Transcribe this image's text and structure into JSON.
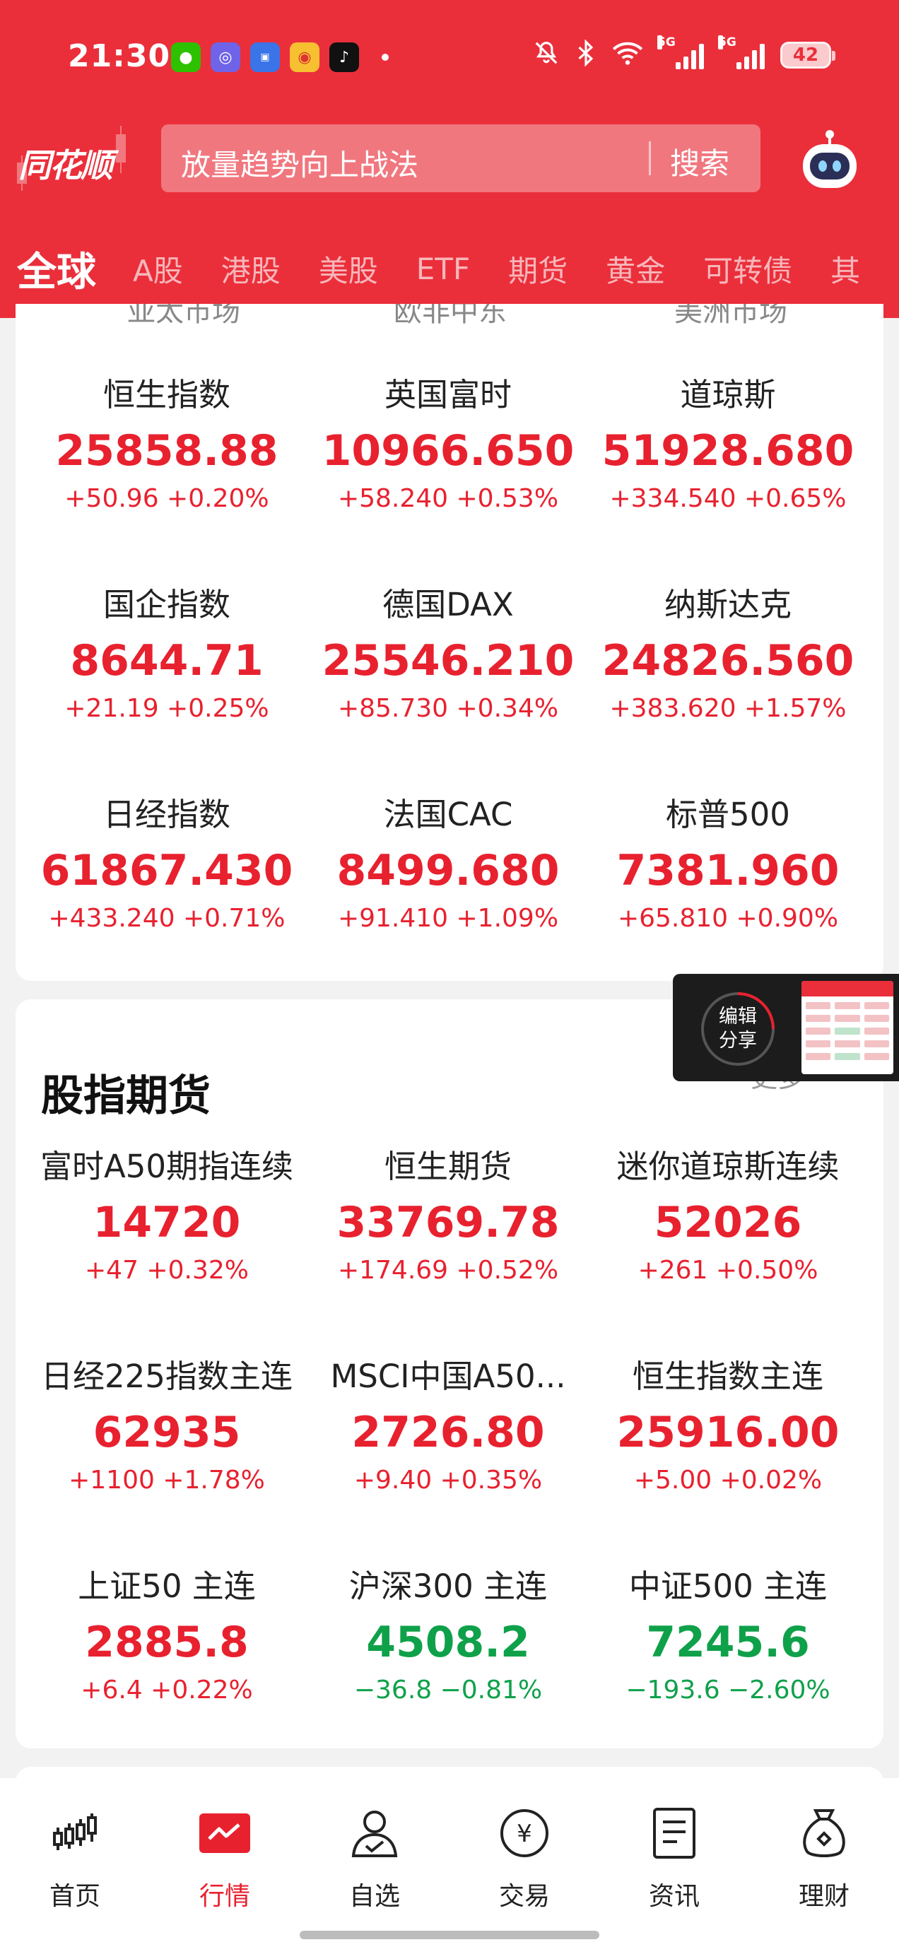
{
  "status_bar": {
    "time": "21:30",
    "network_1": "5G",
    "network_2": "5G",
    "battery": "42"
  },
  "header": {
    "logo": "同花顺",
    "search_placeholder": "放量趋势向上战法",
    "search_button": "搜索"
  },
  "tabs": [
    {
      "label": "全球",
      "active": true
    },
    {
      "label": "A股"
    },
    {
      "label": "港股"
    },
    {
      "label": "美股"
    },
    {
      "label": "ETF"
    },
    {
      "label": "期货"
    },
    {
      "label": "黄金"
    },
    {
      "label": "可转债"
    },
    {
      "label": "其"
    }
  ],
  "global_indices": {
    "cut_labels": [
      "亚太市场",
      "欧非中东",
      "美洲市场"
    ],
    "items": [
      {
        "name": "恒生指数",
        "price": "25858.88",
        "change": "+50.96  +0.20%",
        "dir": "up"
      },
      {
        "name": "英国富时",
        "price": "10966.650",
        "change": "+58.240  +0.53%",
        "dir": "up"
      },
      {
        "name": "道琼斯",
        "price": "51928.680",
        "change": "+334.540  +0.65%",
        "dir": "up"
      },
      {
        "name": "国企指数",
        "price": "8644.71",
        "change": "+21.19  +0.25%",
        "dir": "up"
      },
      {
        "name": "德国DAX",
        "price": "25546.210",
        "change": "+85.730  +0.34%",
        "dir": "up"
      },
      {
        "name": "纳斯达克",
        "price": "24826.560",
        "change": "+383.620  +1.57%",
        "dir": "up"
      },
      {
        "name": "日经指数",
        "price": "61867.430",
        "change": "+433.240  +0.71%",
        "dir": "up"
      },
      {
        "name": "法国CAC",
        "price": "8499.680",
        "change": "+91.410  +1.09%",
        "dir": "up"
      },
      {
        "name": "标普500",
        "price": "7381.960",
        "change": "+65.810  +0.90%",
        "dir": "up"
      }
    ]
  },
  "futures": {
    "title": "股指期货",
    "more": "更多",
    "items": [
      {
        "name": "富时A50期指连续",
        "price": "14720",
        "change": "+47  +0.32%",
        "dir": "up"
      },
      {
        "name": "恒生期货",
        "price": "33769.78",
        "change": "+174.69  +0.52%",
        "dir": "up"
      },
      {
        "name": "迷你道琼斯连续",
        "price": "52026",
        "change": "+261  +0.50%",
        "dir": "up"
      },
      {
        "name": "日经225指数主连",
        "price": "62935",
        "change": "+1100  +1.78%",
        "dir": "up"
      },
      {
        "name": "MSCI中国A50...",
        "price": "2726.80",
        "change": "+9.40  +0.35%",
        "dir": "up"
      },
      {
        "name": "恒生指数主连",
        "price": "25916.00",
        "change": "+5.00  +0.02%",
        "dir": "up"
      },
      {
        "name": "上证50 主连",
        "price": "2885.8",
        "change": "+6.4  +0.22%",
        "dir": "up"
      },
      {
        "name": "沪深300 主连",
        "price": "4508.2",
        "change": "−36.8  −0.81%",
        "dir": "down"
      },
      {
        "name": "中证500 主连",
        "price": "7245.6",
        "change": "−193.6  −2.60%",
        "dir": "down"
      }
    ]
  },
  "float_share": {
    "line1": "编辑",
    "line2": "分享"
  },
  "bottom_nav": [
    {
      "label": "首页",
      "icon": "chart-candles-icon"
    },
    {
      "label": "行情",
      "icon": "market-trend-icon",
      "active": true
    },
    {
      "label": "自选",
      "icon": "person-check-icon"
    },
    {
      "label": "交易",
      "icon": "yuan-coin-icon"
    },
    {
      "label": "资讯",
      "icon": "document-icon"
    },
    {
      "label": "理财",
      "icon": "money-bag-icon"
    }
  ],
  "colors": {
    "brand_red": "#ea2f3b",
    "up": "#e8212f",
    "down": "#0fa14a"
  }
}
